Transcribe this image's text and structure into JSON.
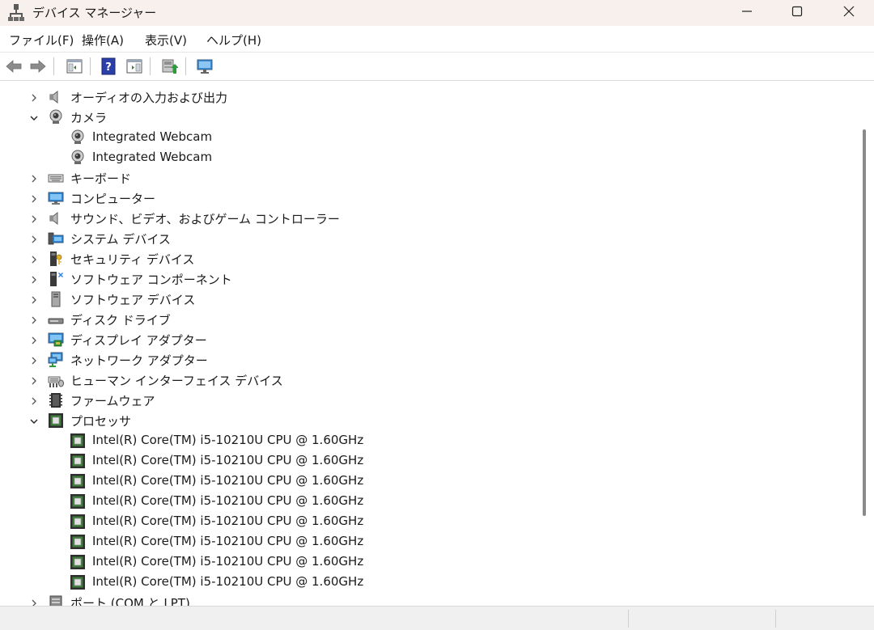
{
  "window": {
    "title": "デバイス マネージャー",
    "icons": {
      "app": "device-manager-icon",
      "minimize": "minimize-icon",
      "maximize": "maximize-icon",
      "close": "close-icon"
    }
  },
  "menu": {
    "items": [
      "ファイル(F)",
      "操作(A)",
      "表示(V)",
      "ヘルプ(H)"
    ]
  },
  "toolbar": {
    "buttons": [
      "back-arrow-icon",
      "forward-arrow-icon",
      "show-hide-console-tree-icon",
      "help-icon",
      "show-hide-action-pane-icon",
      "update-driver-icon",
      "scan-hardware-icon"
    ]
  },
  "tree": {
    "rows": [
      {
        "label": "オーディオの入力および出力",
        "level": 0,
        "state": "collapsed",
        "icon": "audio-icon"
      },
      {
        "label": "カメラ",
        "level": 0,
        "state": "expanded",
        "icon": "camera-icon"
      },
      {
        "label": "Integrated Webcam",
        "level": 1,
        "state": "none",
        "icon": "webcam-icon"
      },
      {
        "label": "Integrated Webcam",
        "level": 1,
        "state": "none",
        "icon": "webcam-icon"
      },
      {
        "label": "キーボード",
        "level": 0,
        "state": "collapsed",
        "icon": "keyboard-icon"
      },
      {
        "label": "コンピューター",
        "level": 0,
        "state": "collapsed",
        "icon": "computer-icon"
      },
      {
        "label": "サウンド、ビデオ、およびゲーム コントローラー",
        "level": 0,
        "state": "collapsed",
        "icon": "sound-icon"
      },
      {
        "label": "システム デバイス",
        "level": 0,
        "state": "collapsed",
        "icon": "system-device-icon"
      },
      {
        "label": "セキュリティ デバイス",
        "level": 0,
        "state": "collapsed",
        "icon": "security-device-icon"
      },
      {
        "label": "ソフトウェア コンポーネント",
        "level": 0,
        "state": "collapsed",
        "icon": "software-component-icon"
      },
      {
        "label": "ソフトウェア デバイス",
        "level": 0,
        "state": "collapsed",
        "icon": "software-device-icon"
      },
      {
        "label": "ディスク ドライブ",
        "level": 0,
        "state": "collapsed",
        "icon": "disk-drive-icon"
      },
      {
        "label": "ディスプレイ アダプター",
        "level": 0,
        "state": "collapsed",
        "icon": "display-adapter-icon"
      },
      {
        "label": "ネットワーク アダプター",
        "level": 0,
        "state": "collapsed",
        "icon": "network-adapter-icon"
      },
      {
        "label": "ヒューマン インターフェイス デバイス",
        "level": 0,
        "state": "collapsed",
        "icon": "hid-icon"
      },
      {
        "label": "ファームウェア",
        "level": 0,
        "state": "collapsed",
        "icon": "firmware-icon"
      },
      {
        "label": "プロセッサ",
        "level": 0,
        "state": "expanded",
        "icon": "processor-icon"
      },
      {
        "label": "Intel(R) Core(TM) i5-10210U CPU @ 1.60GHz",
        "level": 1,
        "state": "none",
        "icon": "processor-icon"
      },
      {
        "label": "Intel(R) Core(TM) i5-10210U CPU @ 1.60GHz",
        "level": 1,
        "state": "none",
        "icon": "processor-icon"
      },
      {
        "label": "Intel(R) Core(TM) i5-10210U CPU @ 1.60GHz",
        "level": 1,
        "state": "none",
        "icon": "processor-icon"
      },
      {
        "label": "Intel(R) Core(TM) i5-10210U CPU @ 1.60GHz",
        "level": 1,
        "state": "none",
        "icon": "processor-icon"
      },
      {
        "label": "Intel(R) Core(TM) i5-10210U CPU @ 1.60GHz",
        "level": 1,
        "state": "none",
        "icon": "processor-icon"
      },
      {
        "label": "Intel(R) Core(TM) i5-10210U CPU @ 1.60GHz",
        "level": 1,
        "state": "none",
        "icon": "processor-icon"
      },
      {
        "label": "Intel(R) Core(TM) i5-10210U CPU @ 1.60GHz",
        "level": 1,
        "state": "none",
        "icon": "processor-icon"
      },
      {
        "label": "Intel(R) Core(TM) i5-10210U CPU @ 1.60GHz",
        "level": 1,
        "state": "none",
        "icon": "processor-icon"
      },
      {
        "label": "ポート (COM と LPT)",
        "level": 0,
        "state": "collapsed",
        "icon": "port-icon"
      }
    ]
  },
  "colors": {
    "titlebar_bg": "#f7f0ec",
    "chip_green": "#3e7d3a",
    "chip_dark": "#2f2f2f",
    "monitor_blue": "#2a86d6"
  }
}
